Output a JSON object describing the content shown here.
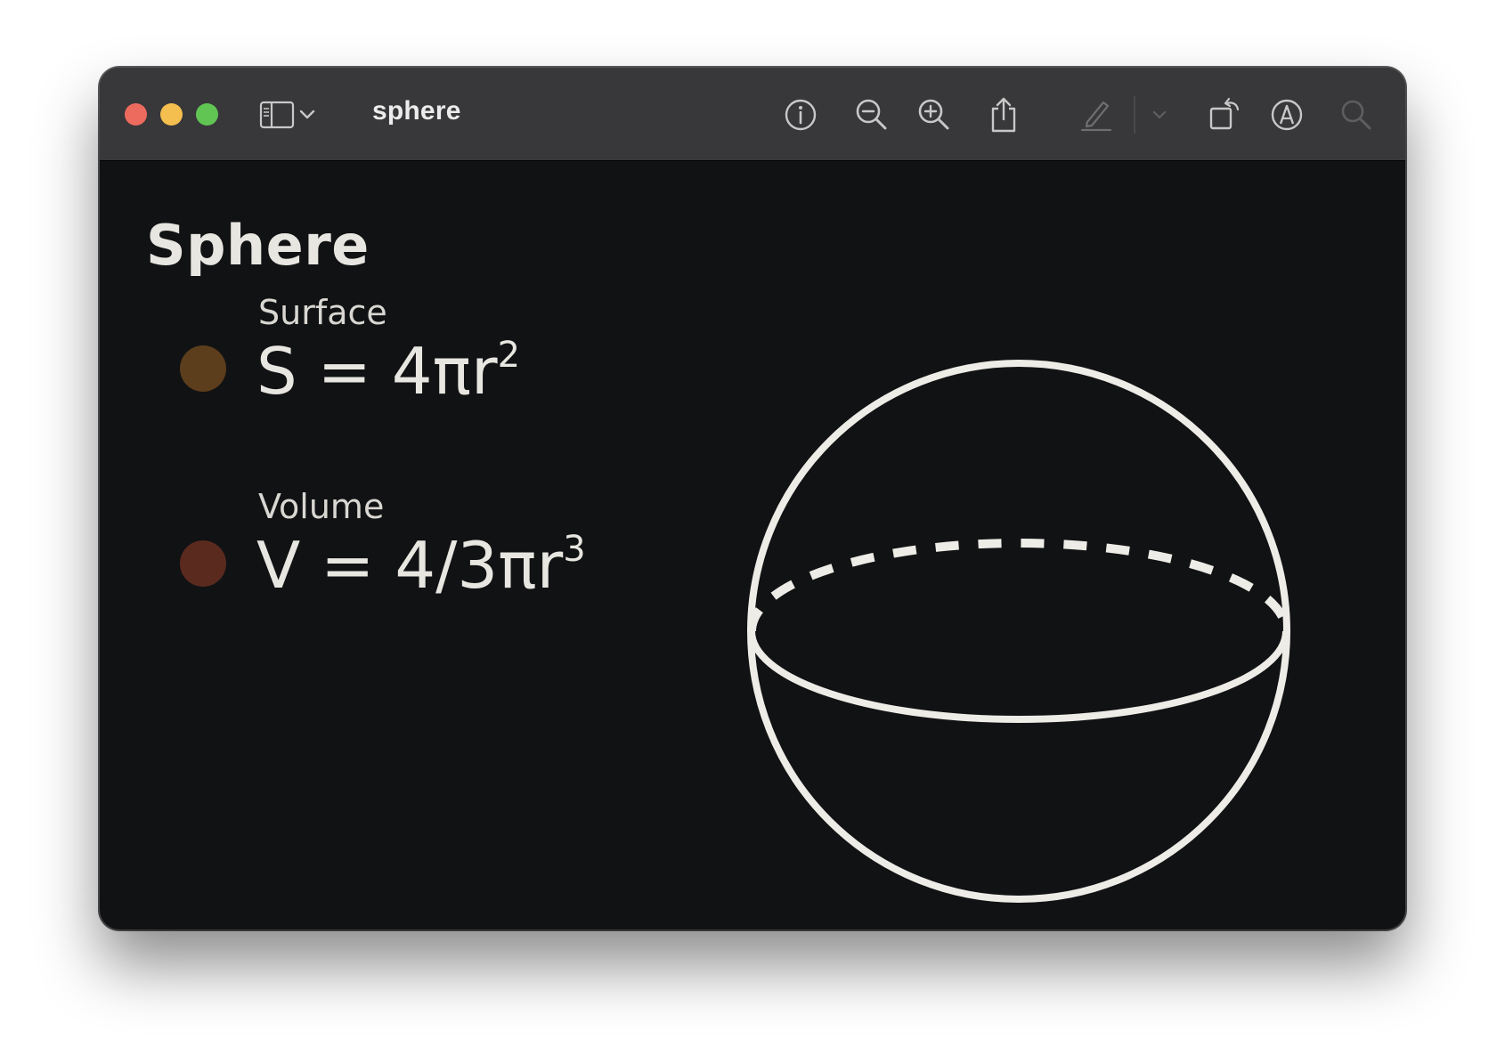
{
  "window": {
    "title": "sphere",
    "traffic_lights": {
      "close_color": "#ed6a5e",
      "minimize_color": "#f5bf4f",
      "maximize_color": "#61c554"
    }
  },
  "toolbar": {
    "icons": [
      "sidebar-icon",
      "chevron-down-icon",
      "info-icon",
      "zoom-out-icon",
      "zoom-in-icon",
      "share-icon",
      "markup-pen-icon",
      "chevron-down-icon",
      "rotate-icon",
      "markup-icon",
      "search-icon"
    ]
  },
  "document": {
    "heading": "Sphere",
    "items": [
      {
        "label": "Surface",
        "formula_main": "S = 4πr",
        "formula_exp": "2",
        "dot_color": "#5c3d1c"
      },
      {
        "label": "Volume",
        "formula_main": "V = 4/3πr",
        "formula_exp": "3",
        "dot_color": "#5a2a1f"
      }
    ]
  },
  "colors": {
    "background": "#111214",
    "titlebar": "#38383a",
    "stroke": "#eeece6"
  }
}
